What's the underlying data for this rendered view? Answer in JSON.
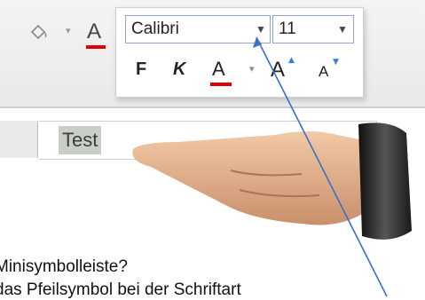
{
  "ribbon": {
    "fill_icon": "fill-bucket-icon",
    "font_color_icon": "font-color-icon",
    "font_color_letter": "A",
    "accent_red": "#e00000"
  },
  "mini_toolbar": {
    "font_name": "Calibri",
    "font_size": "11",
    "bold_label": "F",
    "italic_label": "K",
    "font_color_label": "A",
    "grow_font_label": "A",
    "shrink_font_label": "A"
  },
  "sheet": {
    "cell_value": "Test"
  },
  "captions": {
    "line1": "Minisymbolleiste?",
    "line2": "das Pfeilsymbol bei der Schriftart"
  }
}
